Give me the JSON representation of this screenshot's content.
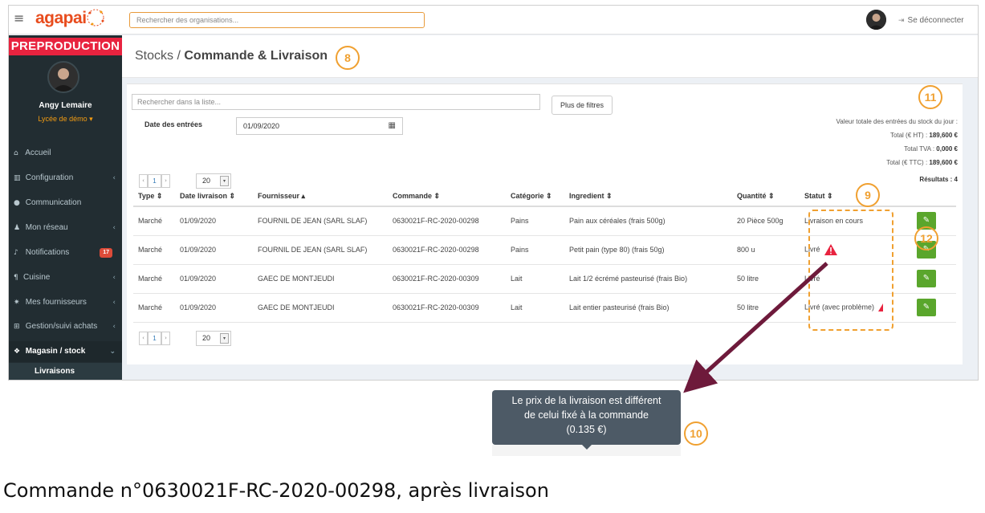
{
  "topbar": {
    "logo": "agapai",
    "search_placeholder": "Rechercher des organisations...",
    "logout_label": "Se déconnecter"
  },
  "sidebar": {
    "env_label": "PREPRODUCTION",
    "user_name": "Angy Lemaire",
    "school": "Lycée de démo",
    "items": [
      {
        "label": "Accueil",
        "icon": "home-icon"
      },
      {
        "label": "Configuration",
        "icon": "bank-icon"
      },
      {
        "label": "Communication",
        "icon": "chat-icon"
      },
      {
        "label": "Mon réseau",
        "icon": "users-icon"
      },
      {
        "label": "Notifications",
        "icon": "bell-icon",
        "badge": "17"
      },
      {
        "label": "Cuisine",
        "icon": "cutlery-icon"
      },
      {
        "label": "Mes fournisseurs",
        "icon": "handshake-icon"
      },
      {
        "label": "Gestion/suivi achats",
        "icon": "cart-icon"
      },
      {
        "label": "Magasin / stock",
        "icon": "cubes-icon"
      }
    ],
    "submenu": "Livraisons"
  },
  "breadcrumb": {
    "parent": "Stocks",
    "separator": " / ",
    "current": "Commande & Livraison"
  },
  "filters": {
    "search_placeholder": "Rechercher dans la liste...",
    "more_filters": "Plus de filtres",
    "date_label": "Date des entrées",
    "date_value": "01/09/2020"
  },
  "totals": {
    "title": "Valeur totale des entrées du stock du jour :",
    "ht_label": "Total (€ HT) :",
    "ht_value": "189,600 €",
    "tva_label": "Total TVA :",
    "tva_value": "0,000 €",
    "ttc_label": "Total (€ TTC) :",
    "ttc_value": "189,600 €",
    "results": "Résultats : 4"
  },
  "pager": {
    "page": "1",
    "per_page": "20"
  },
  "table": {
    "headers": [
      "Type ⇕",
      "Date livraison ⇕",
      "Fournisseur ▴",
      "Commande ⇕",
      "Catégorie ⇕",
      "Ingredient ⇕",
      "Quantité ⇕",
      "Statut ⇕"
    ],
    "rows": [
      {
        "type": "Marché",
        "date": "01/09/2020",
        "supplier": "FOURNIL DE JEAN (SARL SLAF)",
        "order": "0630021F-RC-2020-00298",
        "category": "Pains",
        "ingredient": "Pain aux céréales (frais 500g)",
        "qty": "20 Pièce 500g",
        "status": "Livraison en cours"
      },
      {
        "type": "Marché",
        "date": "01/09/2020",
        "supplier": "FOURNIL DE JEAN (SARL SLAF)",
        "order": "0630021F-RC-2020-00298",
        "category": "Pains",
        "ingredient": "Petit pain (type 80) (frais 50g)",
        "qty": "800 u",
        "status": "Livré"
      },
      {
        "type": "Marché",
        "date": "01/09/2020",
        "supplier": "GAEC DE MONTJEUDI",
        "order": "0630021F-RC-2020-00309",
        "category": "Lait",
        "ingredient": "Lait 1/2 écrémé pasteurisé (frais Bio)",
        "qty": "50 litre",
        "status": "Livré"
      },
      {
        "type": "Marché",
        "date": "01/09/2020",
        "supplier": "GAEC DE MONTJEUDI",
        "order": "0630021F-RC-2020-00309",
        "category": "Lait",
        "ingredient": "Lait entier pasteurisé (frais Bio)",
        "qty": "50 litre",
        "status": "Livré (avec problème)"
      }
    ]
  },
  "annotations": {
    "n8": "8",
    "n9": "9",
    "n10": "10",
    "n11": "11",
    "n12": "12"
  },
  "tooltip": {
    "line1": "Le prix de la livraison est différent",
    "line2": "de celui fixé à la commande",
    "line3": "(0.135 €)"
  },
  "caption": "Commande n°0630021F-RC-2020-00298, après livraison",
  "colors": {
    "accent": "#f0a030",
    "brand": "#e84c1d",
    "edit": "#5aa62c",
    "warning": "#e8233f",
    "arrow": "#6e1a3b"
  }
}
